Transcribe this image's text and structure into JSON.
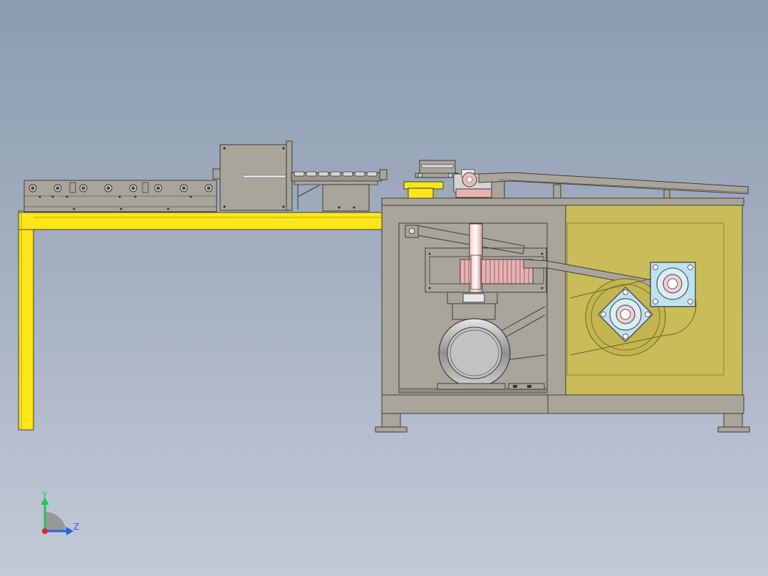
{
  "view": {
    "background_top": "#8c9cb1",
    "background_bottom": "#c3cad7"
  },
  "triad": {
    "y_label": "Y",
    "z_label": "Z",
    "y_color": "#22c55e",
    "z_color": "#2563eb",
    "origin_color": "#dc2626"
  },
  "colors": {
    "frame_yellow": "#ffe619",
    "steel_gray": "#a9a59a",
    "guard_olive": "#c9bd5a",
    "bearing_blue": "#bfe3ee",
    "gear_pink": "#e9b3b3",
    "outline": "#3a3a3a"
  },
  "icons": {
    "triad": "xyz-axis-triad-icon",
    "bearings": "flange-bearing-icon",
    "motor": "motor-icon"
  }
}
